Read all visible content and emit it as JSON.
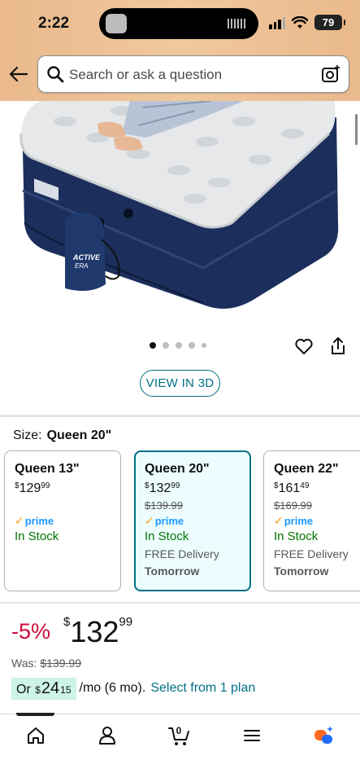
{
  "status_bar": {
    "time": "2:22",
    "battery": "79",
    "icons": [
      "signal-icon",
      "wifi-icon",
      "battery-icon"
    ]
  },
  "header": {
    "search_placeholder": "Search or ask a question",
    "icons": [
      "back-arrow-icon",
      "search-icon",
      "camera-search-icon"
    ]
  },
  "product": {
    "image_brand_text": "ACTIVE ERA",
    "carousel": {
      "total_dots": 5,
      "active_index": 0
    },
    "view_3d_label": "VIEW IN 3D"
  },
  "size": {
    "label": "Size:",
    "selected": "Queen 20\"",
    "options": [
      {
        "title": "Queen 13\"",
        "price_symbol": "$",
        "price_whole": "129",
        "price_cents": "99",
        "was_price": "",
        "prime": "prime",
        "stock": "In Stock",
        "delivery": "",
        "delivery_day": "",
        "selected": false
      },
      {
        "title": "Queen 20\"",
        "price_symbol": "$",
        "price_whole": "132",
        "price_cents": "99",
        "was_price": "$139.99",
        "prime": "prime",
        "stock": "In Stock",
        "delivery": "FREE Delivery",
        "delivery_day": "Tomorrow",
        "selected": true
      },
      {
        "title": "Queen 22\"",
        "price_symbol": "$",
        "price_whole": "161",
        "price_cents": "49",
        "was_price": "$169.99",
        "prime": "prime",
        "stock": "In Stock",
        "delivery": "FREE Delivery",
        "delivery_day": "Tomorrow",
        "selected": false
      }
    ]
  },
  "pricing": {
    "discount": "-5%",
    "symbol": "$",
    "whole": "132",
    "cents": "99",
    "was_label": "Was:",
    "was_price": "$139.99",
    "monthly_prefix": "Or",
    "monthly_symbol": "$",
    "monthly_whole": "24",
    "monthly_cents": "15",
    "monthly_suffix": "/mo (6 mo).",
    "plan_link": "Select from 1 plan"
  },
  "bottom_nav": {
    "items": [
      "home-icon",
      "account-icon",
      "cart-icon",
      "menu-icon",
      "rufus-icon"
    ],
    "cart_count": "0"
  },
  "colors": {
    "header_bg": "#f0c89e",
    "link": "#007185",
    "discount": "#cc0c39",
    "in_stock": "#007600",
    "prime_blue": "#1a98ff",
    "prime_check": "#ff9900",
    "monthly_highlight": "#cdf4e5"
  }
}
